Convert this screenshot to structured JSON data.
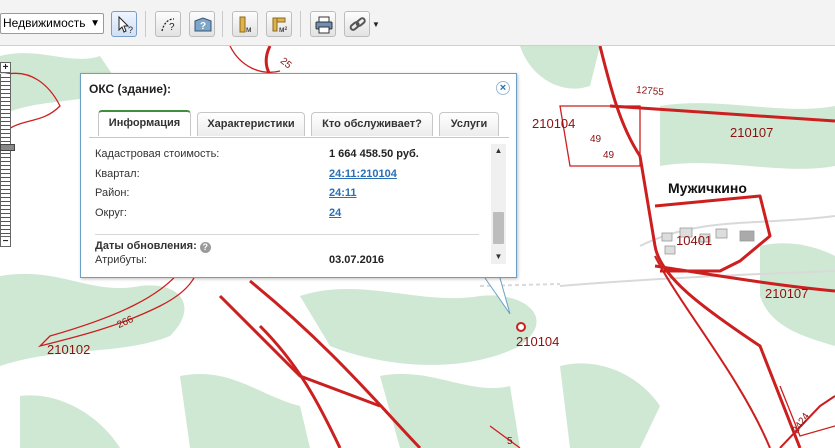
{
  "toolbar": {
    "layer_select_value": "Недвижимость"
  },
  "map": {
    "parcel_labels": [
      {
        "text": "210104"
      },
      {
        "text": "210107"
      },
      {
        "text": "210107"
      },
      {
        "text": "210104"
      },
      {
        "text": "210102"
      },
      {
        "text": "10401"
      }
    ],
    "small_numbers": [
      {
        "text": "12755"
      },
      {
        "text": "49"
      },
      {
        "text": "49"
      },
      {
        "text": "266"
      },
      {
        "text": "25"
      },
      {
        "text": "2424"
      },
      {
        "text": "5"
      }
    ],
    "settlement": "Мужичкино"
  },
  "popup": {
    "title": "ОКС (здание):",
    "close_label": "×",
    "tabs": [
      {
        "label": "Информация",
        "active": true
      },
      {
        "label": "Характеристики",
        "active": false
      },
      {
        "label": "Кто обслуживает?",
        "active": false
      },
      {
        "label": "Услуги",
        "active": false
      }
    ],
    "rows": [
      {
        "key": "Кадастровая стоимость:",
        "value": "1 664 458.50 руб.",
        "link": false
      },
      {
        "key": "Квартал:",
        "value": "24:11:210104",
        "link": true
      },
      {
        "key": "Район:",
        "value": "24:11",
        "link": true
      },
      {
        "key": "Округ:",
        "value": "24",
        "link": true
      }
    ],
    "section_title": "Даты обновления:",
    "attr_key": "Атрибуты:",
    "attr_value": "03.07.2016"
  },
  "colors": {
    "boundary": "#cc1f1f",
    "forest": "#cfe8d3",
    "popup_border": "#6aa0c8",
    "link": "#2a6fb5"
  }
}
